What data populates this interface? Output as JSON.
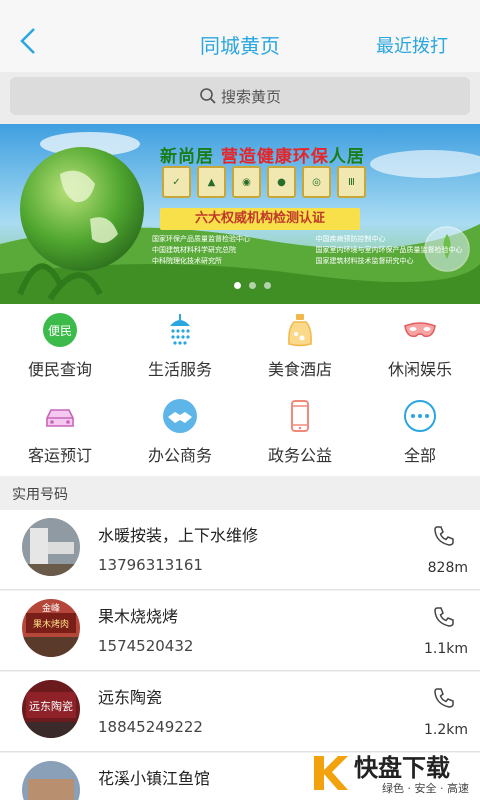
{
  "header": {
    "title": "同城黄页",
    "recent_label": "最近拨打",
    "back_icon": "chevron-left-icon"
  },
  "search": {
    "placeholder": "搜索黄页",
    "icon": "search-icon"
  },
  "banner": {
    "title_part1": "新尚居 ",
    "title_part2": "营造健康环保",
    "title_part3": "人居",
    "subtitle": "六大权威机构检测认证",
    "cert_lines": [
      "国家环保产品质量监督检验中心",
      "中国建筑材料科学研究总院",
      "中科院理化技术研究所",
      "中国疾病预防控制中心",
      "国家室内环境与室内环保产品质量监督检验中心",
      "国家建筑材料技术监督研究中心"
    ],
    "active_slide": 1,
    "slide_count": 3
  },
  "categories": [
    {
      "label": "便民查询",
      "icon": "citizen-service-icon",
      "icon_text": "便民"
    },
    {
      "label": "生活服务",
      "icon": "shower-icon"
    },
    {
      "label": "美食酒店",
      "icon": "bottle-icon"
    },
    {
      "label": "休闲娱乐",
      "icon": "mask-icon"
    },
    {
      "label": "客运预订",
      "icon": "car-icon"
    },
    {
      "label": "办公商务",
      "icon": "handshake-icon"
    },
    {
      "label": "政务公益",
      "icon": "mobile-phone-icon"
    },
    {
      "label": "全部",
      "icon": "more-icon"
    }
  ],
  "section": {
    "title": "实用号码"
  },
  "listings": [
    {
      "name": "水暖按装，上下水维修",
      "phone": "13796313161",
      "distance": "828m"
    },
    {
      "name": "果木烧烧烤",
      "phone": "1574520432",
      "distance": "1.1km"
    },
    {
      "name": "远东陶瓷",
      "phone": "18845249222",
      "distance": "1.2km"
    },
    {
      "name": "花溪小镇江鱼馆",
      "phone": "",
      "distance": ""
    }
  ],
  "watermark": {
    "brand_k": "K",
    "brand": "快盘下载",
    "tagline": "绿色 · 安全 · 高速"
  },
  "colors": {
    "accent": "#2aa6e0",
    "green": "#3dbb4a"
  }
}
